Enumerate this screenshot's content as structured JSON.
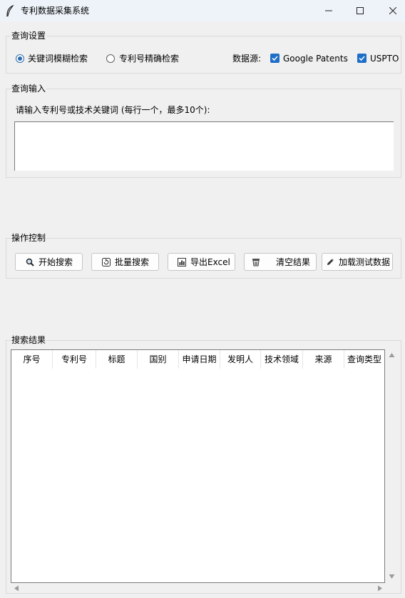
{
  "window": {
    "title": "专利数据采集系统"
  },
  "query_settings": {
    "legend": "查询设置",
    "fuzzy_label": "关键词模糊检索",
    "exact_label": "专利号精确检索",
    "source_label": "数据源:",
    "google_label": "Google Patents",
    "uspto_label": "USPTO"
  },
  "query_input": {
    "legend": "查询输入",
    "prompt": "请输入专利号或技术关键词 (每行一个，最多10个):",
    "value": ""
  },
  "controls": {
    "legend": "操作控制",
    "start_search": "开始搜索",
    "batch_search": "批量搜索",
    "export_excel": "导出Excel",
    "clear_results": "清空结果",
    "load_test_data": "加载测试数据"
  },
  "results": {
    "legend": "搜索结果",
    "columns": [
      "序号",
      "专利号",
      "标题",
      "国别",
      "申请日期",
      "发明人",
      "技术领域",
      "来源",
      "查询类型"
    ],
    "rows": []
  },
  "colors": {
    "accent": "#1f6fc8",
    "titlebar": "#eef3f9",
    "background": "#f0f0f0"
  },
  "icons": {
    "app": "feather-icon",
    "start": "magnifier-icon",
    "batch": "refresh-icon",
    "export": "bar-chart-icon",
    "clear": "wastebasket-icon",
    "load": "pencil-icon"
  }
}
